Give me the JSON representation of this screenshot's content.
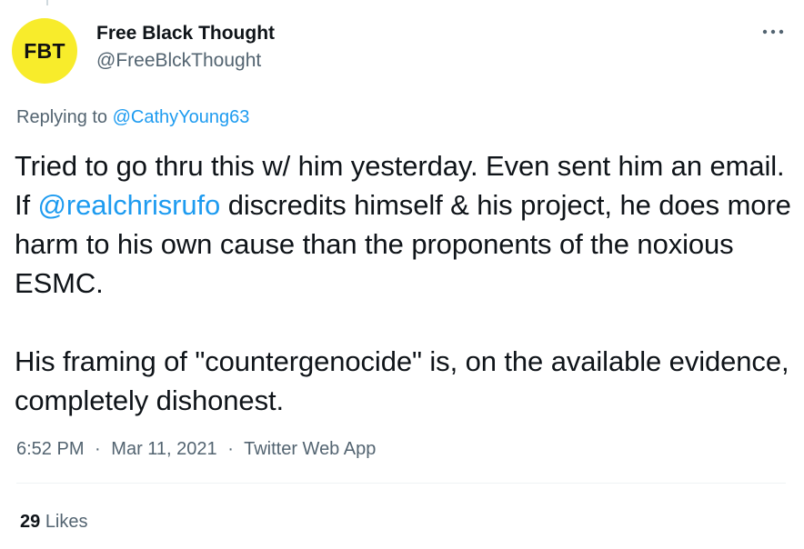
{
  "author": {
    "avatar_text": "FBT",
    "avatar_color": "#f8ec2b",
    "display_name": "Free Black Thought",
    "handle": "@FreeBlckThought"
  },
  "more_icon": "more-dots-icon",
  "reply": {
    "prefix": "Replying to",
    "mention": "@CathyYoung63"
  },
  "tweet": {
    "p1_before": "Tried to go thru this w/ him yesterday. Even sent him an email. If ",
    "p1_mention": "@realchrisrufo",
    "p1_after": " discredits himself & his project, he does more harm to his own cause than the proponents of the noxious ESMC.",
    "p2": "His framing of \"countergenocide\" is, on the available evidence, completely dishonest."
  },
  "meta": {
    "time": "6:52 PM",
    "separator": "·",
    "date": "Mar 11, 2021",
    "source": "Twitter Web App"
  },
  "stats": {
    "likes_count": "29",
    "likes_label": "Likes"
  },
  "colors": {
    "link": "#1d9bf0",
    "secondary_text": "#536471",
    "primary_text": "#0f1419"
  }
}
